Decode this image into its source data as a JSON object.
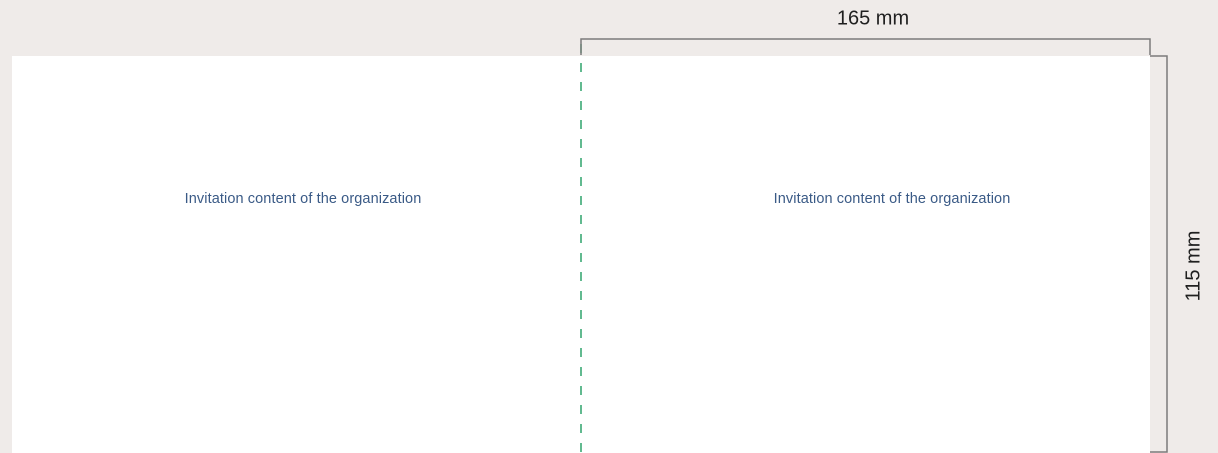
{
  "diagram": {
    "width_label": "165 mm",
    "height_label": "115 mm",
    "panels": [
      {
        "text": "Invitation content of the organization"
      },
      {
        "text": "Invitation content of the organization"
      }
    ]
  },
  "colors": {
    "background": "#efebe9",
    "card": "#ffffff",
    "panel_text": "#3a5a86",
    "fold_line": "#2fa36b",
    "dimension_line": "#7b7b7b"
  }
}
